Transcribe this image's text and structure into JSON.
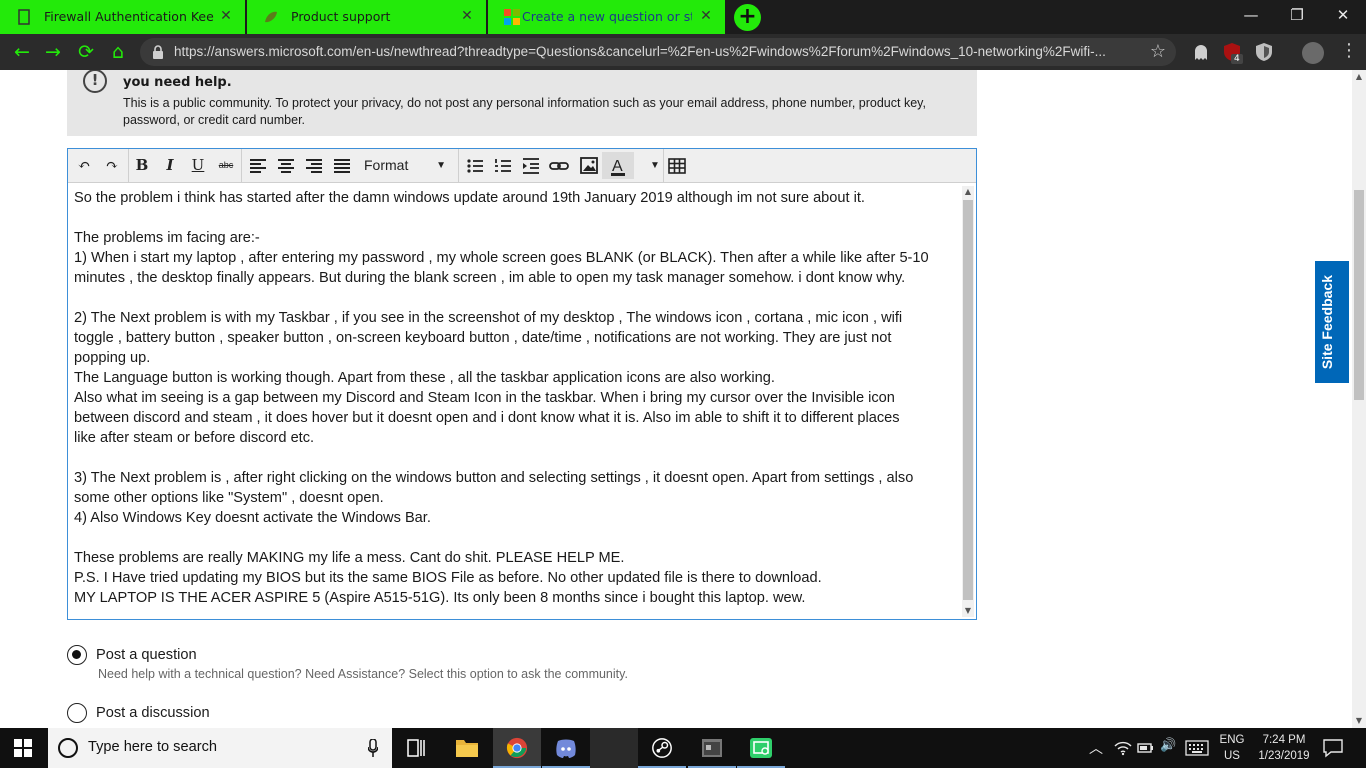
{
  "browser": {
    "tabs": [
      {
        "title": "Firewall Authentication Keepalive",
        "close": "✕"
      },
      {
        "title": "Product support",
        "close": "✕"
      },
      {
        "title": "Create a new question or start a d",
        "close": "✕"
      }
    ],
    "new_tab": "+",
    "window_controls": {
      "minimize": "—",
      "maximize": "❐",
      "close": "✕"
    },
    "nav": {
      "back": "←",
      "forward": "→",
      "reload": "⟳",
      "home": "⌂"
    },
    "url": "https://answers.microsoft.com/en-us/newthread?threadtype=Questions&cancelurl=%2Fen-us%2Fwindows%2Fforum%2Fwindows_10-networking%2Fwifi-...",
    "bookmark_star": "☆",
    "extension_badge": "4",
    "accent": "#23ea0a"
  },
  "notice": {
    "icon": "!",
    "heading": "you need help.",
    "body": "This is a public community. To protect your privacy, do not post any personal information such as your email address, phone number, product key, password, or credit card number."
  },
  "editor": {
    "toolbar": {
      "undo": "↶",
      "redo": "↷",
      "bold": "B",
      "italic": "I",
      "underline": "U",
      "strike": "abc",
      "format_label": "Format",
      "format_caret": "▼",
      "font_color_caret": "▼"
    },
    "lines": [
      "So the problem i think has started after the damn windows update around 19th January 2019 although im not sure about it.",
      "",
      "The problems im facing are:-",
      "1) When i start my laptop , after entering my password , my whole screen goes BLANK (or BLACK). Then after a while like after 5-10",
      "minutes , the desktop finally appears. But during the blank screen , im able to open my task manager somehow. i dont know why.",
      "",
      "2) The Next problem is with my Taskbar , if you see in the screenshot of my desktop , The windows icon , cortana , mic icon , wifi",
      "toggle , battery button , speaker button , on-screen keyboard button , date/time , notifications are not working. They are just not",
      "popping up.",
      "The Language button is working though. Apart from these , all the taskbar application icons are also working.",
      "Also what im seeing is a gap between my Discord and Steam Icon in the taskbar. When i bring my cursor over the Invisible icon",
      "between discord and steam , it does hover but it doesnt open and i dont know what it is. Also im able to shift it to different places",
      "like after steam or before discord etc.",
      "",
      "3) The Next problem is , after right clicking on the windows button and selecting settings , it doesnt open. Apart from settings , also",
      "some other options like \"System\" , doesnt open.",
      "4) Also Windows Key doesnt activate the Windows Bar.",
      "",
      "These problems are really MAKING my life a mess. Cant do shit. PLEASE HELP ME.",
      "P.S. I Have tried updating my BIOS but its the same BIOS File as before. No other updated file is there to download.",
      "MY LAPTOP IS THE ACER ASPIRE 5 (Aspire A515-51G). Its only been 8 months since i bought this laptop. wew."
    ]
  },
  "post_type": {
    "question": {
      "label": "Post a question",
      "description": "Need help with a technical question? Need Assistance? Select this option to ask the community.",
      "selected": true
    },
    "discussion": {
      "label": "Post a discussion",
      "selected": false
    }
  },
  "site_feedback": "Site Feedback",
  "taskbar": {
    "search_placeholder": "Type here to search",
    "tray": {
      "chevron": "︿",
      "volume": "🔊"
    },
    "language": {
      "line1": "ENG",
      "line2": "US"
    },
    "clock": {
      "time": "7:24 PM",
      "date": "1/23/2019"
    }
  }
}
